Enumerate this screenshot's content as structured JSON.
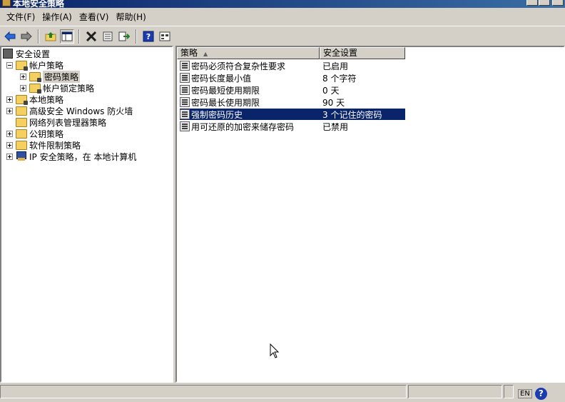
{
  "window": {
    "title": "本地安全策略"
  },
  "menu": [
    {
      "label": "文件(F)"
    },
    {
      "label": "操作(A)"
    },
    {
      "label": "查看(V)"
    },
    {
      "label": "帮助(H)"
    }
  ],
  "toolbar": {
    "buttons": [
      "back-icon",
      "forward-icon",
      "up-folder-icon",
      "show-tree-icon",
      "delete-icon",
      "properties-icon",
      "export-icon",
      "help-icon",
      "view-icon"
    ]
  },
  "tree": {
    "root": "安全设置",
    "items": [
      {
        "label": "帐户策略"
      },
      {
        "label": "密码策略"
      },
      {
        "label": "帐户锁定策略"
      },
      {
        "label": "本地策略"
      },
      {
        "label": "高级安全 Windows 防火墙"
      },
      {
        "label": "网络列表管理器策略"
      },
      {
        "label": "公钥策略"
      },
      {
        "label": "软件限制策略"
      },
      {
        "label": "IP 安全策略，在 本地计算机"
      }
    ]
  },
  "list": {
    "columns": [
      {
        "label": "策略"
      },
      {
        "label": "安全设置"
      }
    ],
    "rows": [
      {
        "name": "密码必须符合复杂性要求",
        "setting": "已启用"
      },
      {
        "name": "密码长度最小值",
        "setting": "8 个字符"
      },
      {
        "name": "密码最短使用期限",
        "setting": "0 天"
      },
      {
        "name": "密码最长使用期限",
        "setting": "90 天"
      },
      {
        "name": "强制密码历史",
        "setting": "3 个记住的密码"
      },
      {
        "name": "用可还原的加密来储存密码",
        "setting": "已禁用"
      }
    ]
  },
  "tray": {
    "language": "EN",
    "help_glyph": "?"
  }
}
